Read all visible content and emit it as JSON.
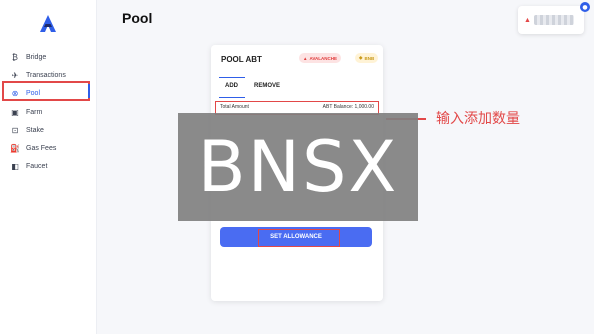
{
  "page": {
    "title": "Pool"
  },
  "sidebar": {
    "items": [
      {
        "label": "Bridge",
        "icon": "bridge-icon",
        "glyph": "₿"
      },
      {
        "label": "Transactions",
        "icon": "send-icon",
        "glyph": "✈"
      },
      {
        "label": "Pool",
        "icon": "pool-icon",
        "glyph": "⊗",
        "active": true
      },
      {
        "label": "Farm",
        "icon": "farm-icon",
        "glyph": "▣"
      },
      {
        "label": "Stake",
        "icon": "stake-icon",
        "glyph": "⊡"
      },
      {
        "label": "Gas Fees",
        "icon": "gas-icon",
        "glyph": "⛽"
      },
      {
        "label": "Faucet",
        "icon": "faucet-icon",
        "glyph": "◧"
      }
    ]
  },
  "card": {
    "title": "POOL ABT",
    "badges": {
      "avalanche": "AVALANCHE",
      "bnb": "BNB"
    },
    "tabs": {
      "add": "ADD",
      "remove": "REMOVE"
    },
    "total_label": "Total Amount",
    "balance": "ABT Balance: 1,000.00",
    "button": "SET ALLOWANCE"
  },
  "annotation": {
    "text": "输入添加数量"
  },
  "watermark": {
    "text": "BNSX"
  },
  "colors": {
    "accent": "#2f5ee8",
    "highlight": "#e24848",
    "button": "#4a6cf2"
  }
}
